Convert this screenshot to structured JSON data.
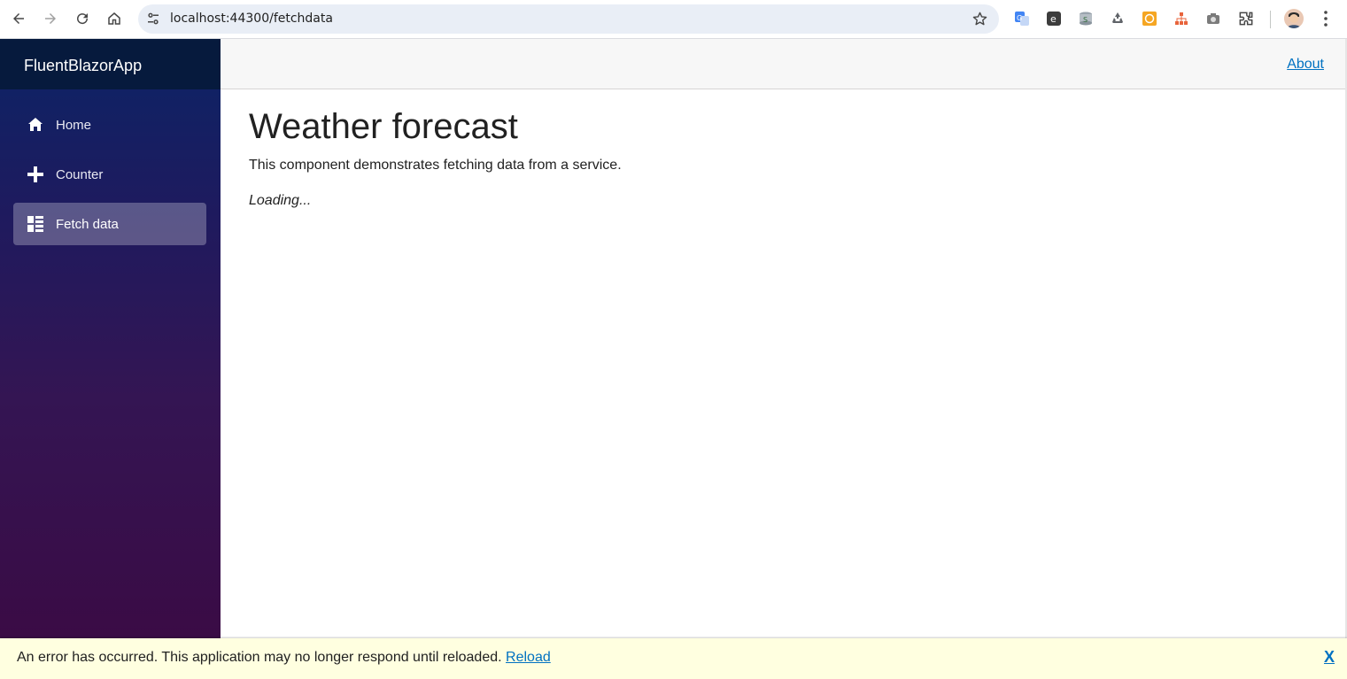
{
  "browser": {
    "url": "localhost:44300/fetchdata",
    "extensions": [
      "translate-icon",
      "evernote-icon",
      "database-icon",
      "recycle-icon",
      "orange-badge-icon",
      "sitemap-icon",
      "camera-icon",
      "puzzle-icon"
    ]
  },
  "app": {
    "brand": "FluentBlazorApp",
    "nav": [
      {
        "label": "Home",
        "icon": "home-icon"
      },
      {
        "label": "Counter",
        "icon": "plus-icon"
      },
      {
        "label": "Fetch data",
        "icon": "list-icon",
        "active": true
      }
    ],
    "topbar": {
      "about": "About"
    }
  },
  "page": {
    "title": "Weather forecast",
    "description": "This component demonstrates fetching data from a service.",
    "loading": "Loading..."
  },
  "error": {
    "message": "An error has occurred. This application may no longer respond until reloaded.",
    "reload": "Reload",
    "dismiss": "X"
  },
  "colors": {
    "accent": "#0071c1",
    "sidebar_top": "#0b2466",
    "sidebar_bottom": "#3a0b45",
    "error_bg": "#ffffe0"
  }
}
